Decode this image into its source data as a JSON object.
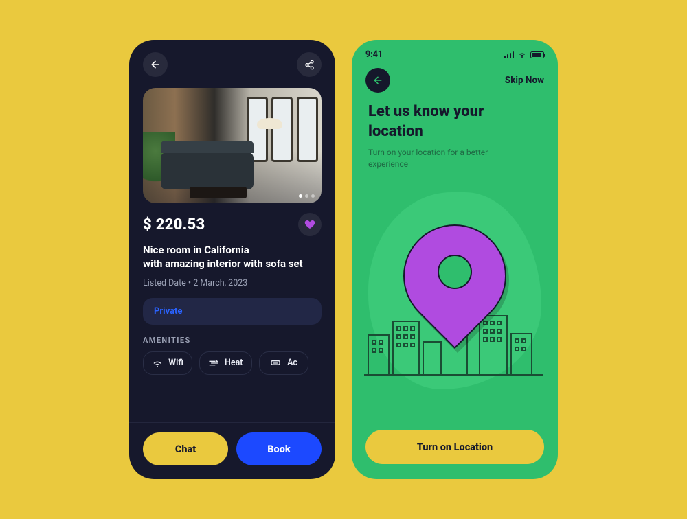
{
  "left": {
    "price": "$ 220.53",
    "title_line1": "Nice room in California",
    "title_line2": "with amazing interior with sofa set",
    "listed_label": "Listed Date",
    "listed_sep": " • ",
    "listed_date": "2 March, 2023",
    "private_tag": "Private",
    "amenities_label": "AMENITIES",
    "amenities": [
      {
        "name": "Wifi"
      },
      {
        "name": "Heat"
      },
      {
        "name": "Ac"
      }
    ],
    "chat_label": "Chat",
    "book_label": "Book"
  },
  "right": {
    "status_time": "9:41",
    "skip_label": "Skip Now",
    "heading_line1": "Let us know your",
    "heading_line2": "location",
    "sub_line1": "Turn on your location for a better",
    "sub_line2": "experience",
    "cta_label": "Turn on Location"
  }
}
